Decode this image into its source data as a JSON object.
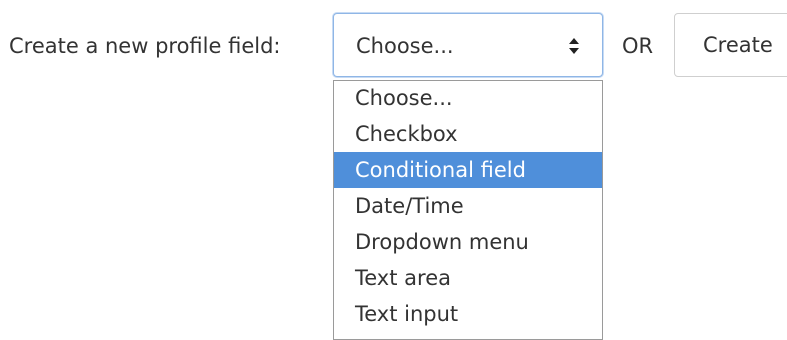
{
  "form": {
    "label": "Create a new profile field:",
    "select": {
      "selected_value": "Choose...",
      "arrow_icon": "updown-chevron-icon"
    },
    "or_text": "OR",
    "create_button_label": "Create"
  },
  "dropdown": {
    "options": [
      "Choose...",
      "Checkbox",
      "Conditional field",
      "Date/Time",
      "Dropdown menu",
      "Text area",
      "Text input"
    ],
    "highlighted_option": "Conditional field"
  },
  "colors": {
    "highlight": "#4f8fda",
    "focus_border": "#8fb6e6",
    "text": "#333333"
  }
}
